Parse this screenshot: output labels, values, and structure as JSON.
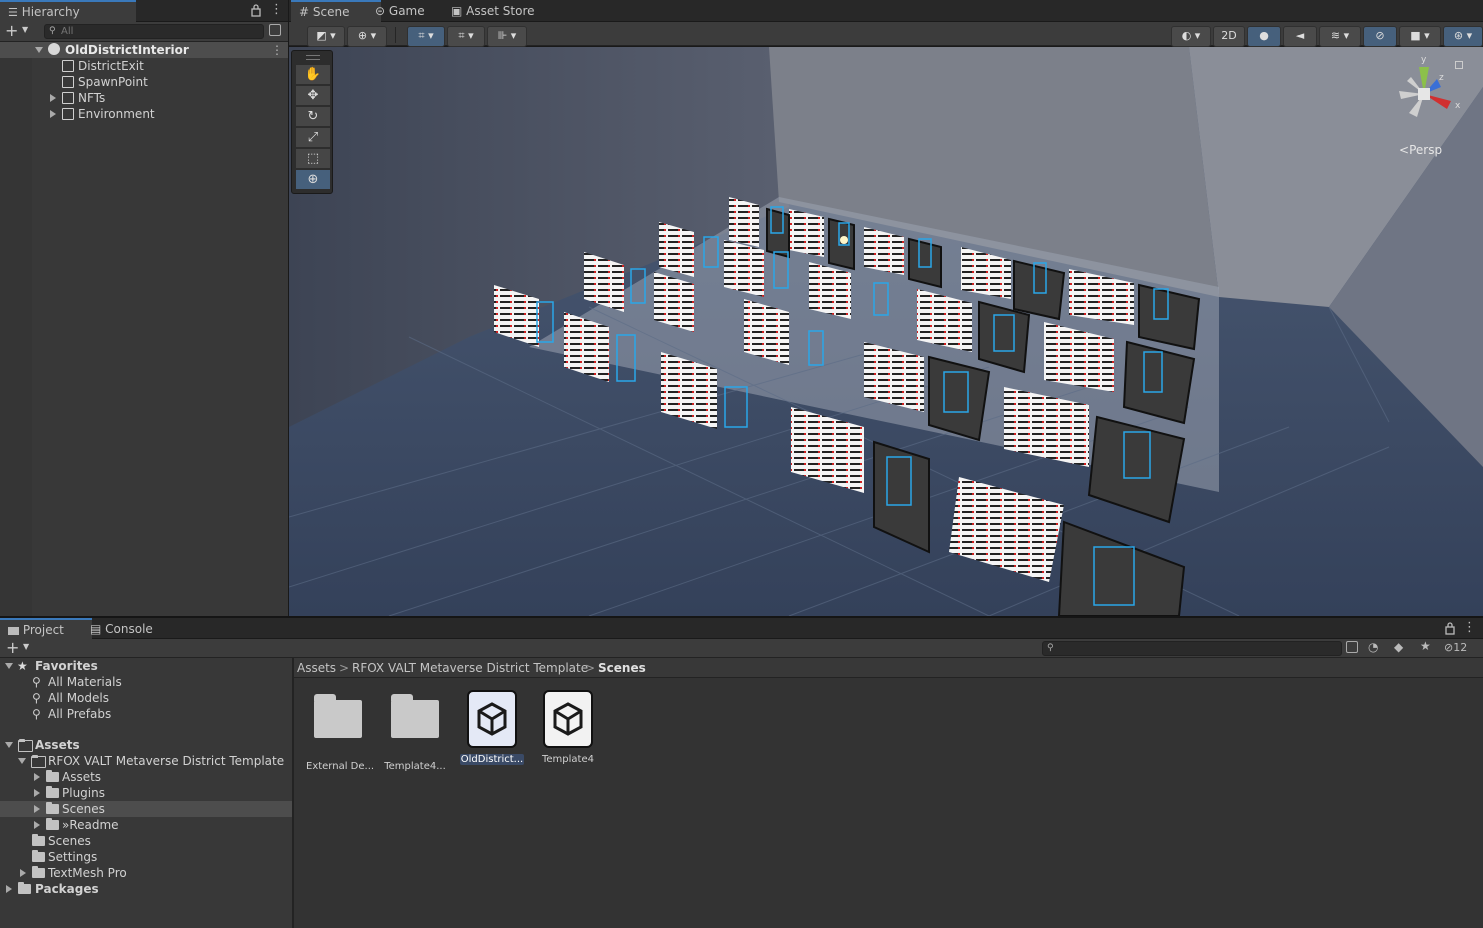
{
  "hierarchy": {
    "tab": "Hierarchy",
    "search_placeholder": "All",
    "scene_name": "OldDistrictInterior",
    "items": [
      {
        "label": "DistrictExit",
        "expandable": false
      },
      {
        "label": "SpawnPoint",
        "expandable": false
      },
      {
        "label": "NFTs",
        "expandable": true
      },
      {
        "label": "Environment",
        "expandable": true
      }
    ]
  },
  "scene_tabs": [
    {
      "label": "Scene",
      "icon": "grid-icon",
      "active": true
    },
    {
      "label": "Game",
      "icon": "gamepad-icon",
      "active": false
    },
    {
      "label": "Asset Store",
      "icon": "shopping-bag-icon",
      "active": false
    }
  ],
  "scene_toolbar": {
    "mode_2d": "2D",
    "persp_label": "Persp",
    "gizmo_y": "y",
    "gizmo_x": "x",
    "gizmo_z": "z"
  },
  "tools": [
    "hand-tool-icon",
    "move-tool-icon",
    "rotate-tool-icon",
    "scale-tool-icon",
    "rect-tool-icon",
    "transform-tool-icon"
  ],
  "bottom_tabs": [
    {
      "label": "Project",
      "icon": "folder-icon",
      "active": true
    },
    {
      "label": "Console",
      "icon": "console-icon",
      "active": false
    }
  ],
  "project": {
    "hidden_count": "12",
    "favorites": {
      "label": "Favorites",
      "items": [
        "All Materials",
        "All Models",
        "All Prefabs"
      ]
    },
    "assets_root": "Assets",
    "template_folder": "RFOX VALT Metaverse District Template",
    "template_children": [
      "Assets",
      "Plugins",
      "Scenes",
      "»Readme"
    ],
    "assets_children": [
      "Scenes",
      "Settings",
      "TextMesh Pro"
    ],
    "packages": "Packages",
    "breadcrumb": [
      "Assets",
      "RFOX VALT Metaverse District Template",
      "Scenes"
    ],
    "files": [
      {
        "label": "External De...",
        "kind": "folder",
        "selected": false
      },
      {
        "label": "Template4...",
        "kind": "folder",
        "selected": false
      },
      {
        "label": "OldDistrict...",
        "kind": "scene",
        "selected": true
      },
      {
        "label": "Template4",
        "kind": "scene",
        "selected": false
      }
    ]
  },
  "colors": {
    "accent": "#3a79bb",
    "panel": "#383838",
    "dark": "#282828"
  }
}
